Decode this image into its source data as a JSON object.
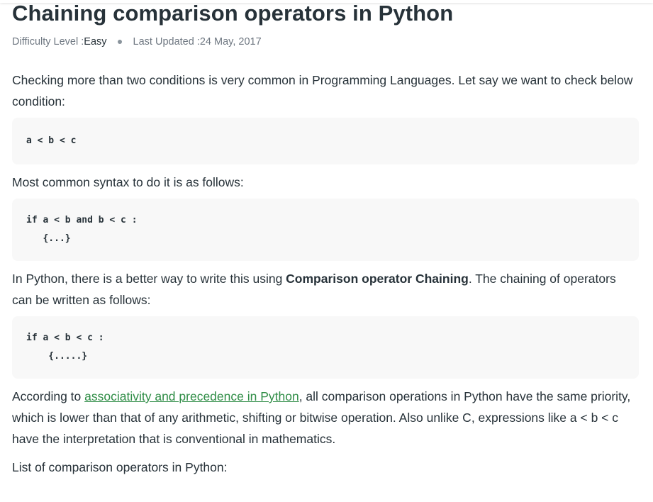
{
  "article": {
    "title": "Chaining comparison operators in Python",
    "meta": {
      "difficulty_label": "Difficulty Level : ",
      "difficulty_value": "Easy",
      "updated_label": "Last Updated : ",
      "updated_value": "24 May, 2017"
    },
    "p1": "Checking more than two conditions is very common in Programming Languages. Let say we want to check below condition:",
    "code1": [
      "a < b < c"
    ],
    "p2": "Most common syntax to do it is as follows:",
    "code2": [
      "if a < b and b < c :",
      "   {...}"
    ],
    "p3": {
      "before": "In Python, there is a better way to write this using ",
      "bold": "Comparison operator Chaining",
      "after": ". The chaining of operators can be written as follows:"
    },
    "code3": [
      "if a < b < c :",
      "    {.....}"
    ],
    "p4": {
      "before": "According to ",
      "link": "associativity and precedence in Python",
      "after": ", all comparison operations in Python have the same priority, which is lower than that of any arithmetic, shifting or bitwise operation. Also unlike C, expressions like a < b < c have the interpretation that is conventional in mathematics."
    },
    "p5": "List of comparison operators in Python:"
  },
  "colors": {
    "text": "#273239",
    "link": "#2f8d46",
    "code_bg": "#f8f8f8",
    "meta": "#6e7781"
  }
}
